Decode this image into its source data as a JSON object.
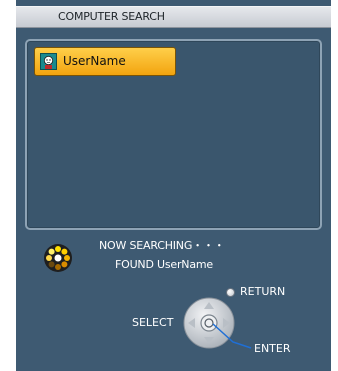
{
  "title": "COMPUTER SEARCH",
  "list": {
    "items": [
      {
        "label": "UserName",
        "icon": "user-avatar-icon",
        "selected": true
      }
    ]
  },
  "status": {
    "line1": "NOW SEARCHING・・・",
    "line2": "FOUND UserName"
  },
  "controls": {
    "return_label": "RETURN",
    "select_label": "SELECT",
    "enter_label": "ENTER"
  },
  "colors": {
    "background": "#3e5a72",
    "selection": "#f6b520",
    "title_bar": "#d4d7dc"
  }
}
